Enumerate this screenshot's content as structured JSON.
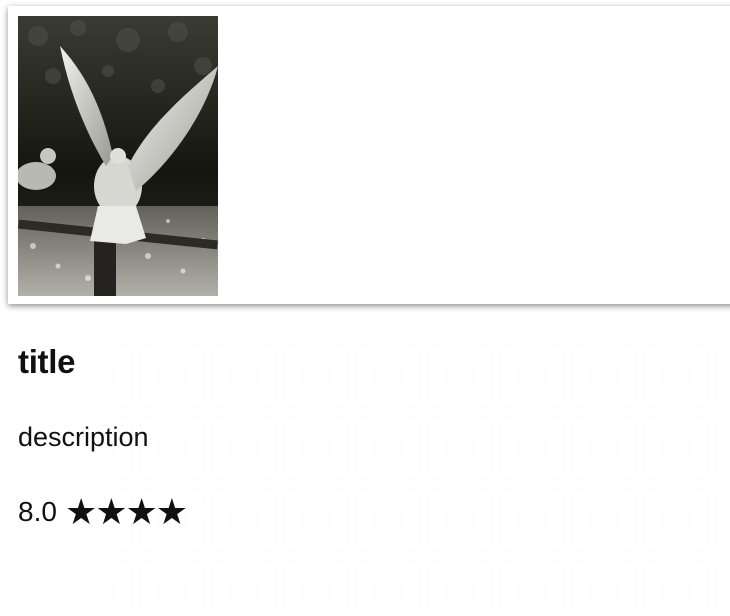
{
  "card": {
    "image_alt": "seagull",
    "title": "title",
    "description": "description",
    "rating": {
      "value_text": "8.0",
      "stars": "★★★★★",
      "filled_fraction": 0.8
    }
  },
  "icons": {
    "star": "star-icon"
  },
  "colors": {
    "text": "#111111",
    "background": "#ffffff",
    "image_bg": "#1a1b16"
  }
}
